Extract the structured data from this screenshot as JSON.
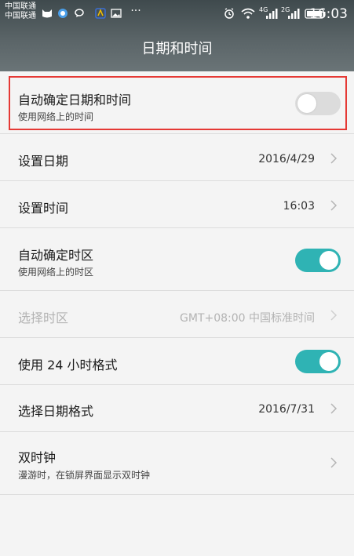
{
  "status_bar": {
    "carrier1": "中国联通",
    "carrier2": "中国联通",
    "more": "···",
    "net1": "4G",
    "net2": "2G",
    "time": "16:03"
  },
  "title": "日期和时间",
  "items": [
    {
      "label": "自动确定日期和时间",
      "sub": "使用网络上的时间",
      "toggle": "off"
    },
    {
      "label": "设置日期",
      "value": "2016/4/29"
    },
    {
      "label": "设置时间",
      "value": "16:03"
    },
    {
      "label": "自动确定时区",
      "sub": "使用网络上的时区",
      "toggle": "on"
    },
    {
      "label": "选择时区",
      "value": "GMT+08:00 中国标准时间",
      "disabled": true
    },
    {
      "label": "使用 24 小时格式",
      "toggle": "on"
    },
    {
      "label": "选择日期格式",
      "value": "2016/7/31"
    },
    {
      "label": "双时钟",
      "sub": "漫游时，在锁屏界面显示双时钟"
    }
  ],
  "colors": {
    "accent": "#2fb3b4",
    "highlight": "#e53935"
  }
}
